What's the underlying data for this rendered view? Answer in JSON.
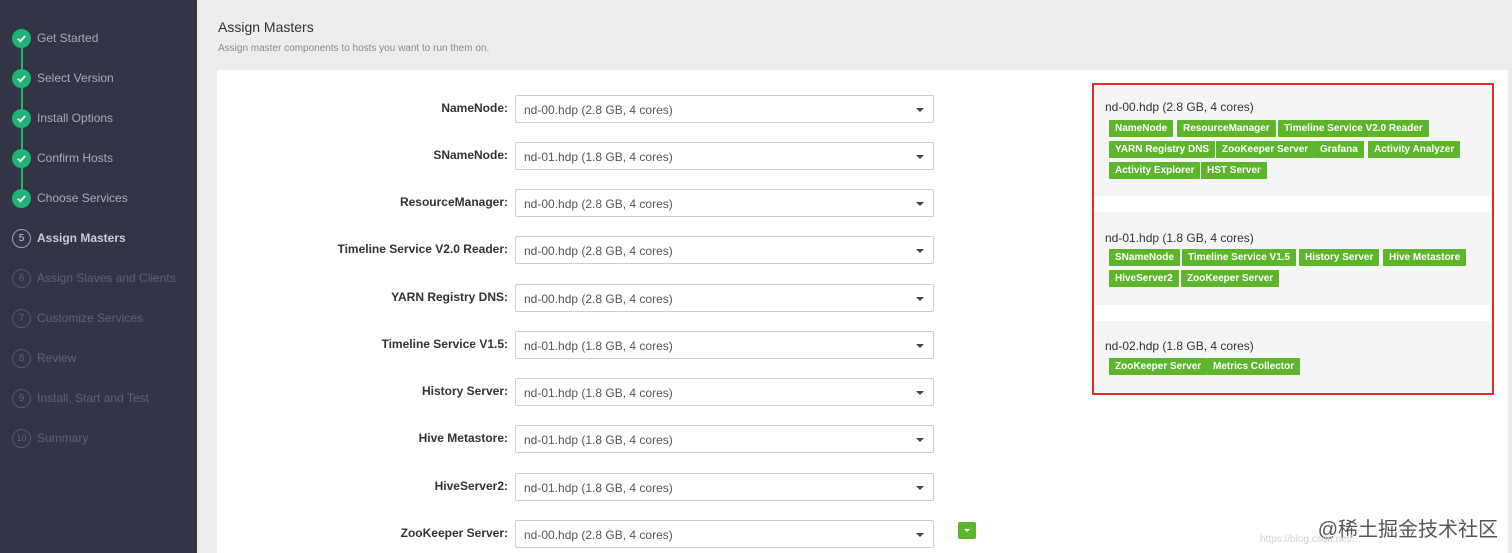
{
  "steps": [
    {
      "label": "Get Started",
      "state": "done"
    },
    {
      "label": "Select Version",
      "state": "done"
    },
    {
      "label": "Install Options",
      "state": "done"
    },
    {
      "label": "Confirm Hosts",
      "state": "done"
    },
    {
      "label": "Choose Services",
      "state": "done"
    },
    {
      "label": "Assign Masters",
      "state": "active",
      "num": "5"
    },
    {
      "label": "Assign Slaves and Clients",
      "state": "todo",
      "num": "6"
    },
    {
      "label": "Customize Services",
      "state": "todo",
      "num": "7"
    },
    {
      "label": "Review",
      "state": "todo",
      "num": "8"
    },
    {
      "label": "Install, Start and Test",
      "state": "todo",
      "num": "9"
    },
    {
      "label": "Summary",
      "state": "todo",
      "num": "10"
    }
  ],
  "header": {
    "title": "Assign Masters",
    "subtitle": "Assign master components to hosts you want to run them on."
  },
  "assignments": [
    {
      "label": "NameNode:",
      "value": "nd-00.hdp (2.8 GB, 4 cores)"
    },
    {
      "label": "SNameNode:",
      "value": "nd-01.hdp (1.8 GB, 4 cores)"
    },
    {
      "label": "ResourceManager:",
      "value": "nd-00.hdp (2.8 GB, 4 cores)"
    },
    {
      "label": "Timeline Service V2.0 Reader:",
      "value": "nd-00.hdp (2.8 GB, 4 cores)"
    },
    {
      "label": "YARN Registry DNS:",
      "value": "nd-00.hdp (2.8 GB, 4 cores)"
    },
    {
      "label": "Timeline Service V1.5:",
      "value": "nd-01.hdp (1.8 GB, 4 cores)"
    },
    {
      "label": "History Server:",
      "value": "nd-01.hdp (1.8 GB, 4 cores)"
    },
    {
      "label": "Hive Metastore:",
      "value": "nd-01.hdp (1.8 GB, 4 cores)"
    },
    {
      "label": "HiveServer2:",
      "value": "nd-01.hdp (1.8 GB, 4 cores)"
    },
    {
      "label": "ZooKeeper Server:",
      "value": "nd-00.hdp (2.8 GB, 4 cores)"
    }
  ],
  "hosts": [
    {
      "name": "nd-00.hdp (2.8 GB, 4 cores)",
      "tags": [
        "NameNode",
        "ResourceManager",
        "Timeline Service V2.0 Reader",
        "YARN Registry DNS",
        "ZooKeeper Server",
        "Grafana",
        "Activity Analyzer",
        "Activity Explorer",
        "HST Server"
      ]
    },
    {
      "name": "nd-01.hdp (1.8 GB, 4 cores)",
      "tags": [
        "SNameNode",
        "Timeline Service V1.5",
        "History Server",
        "Hive Metastore",
        "HiveServer2",
        "ZooKeeper Server"
      ]
    },
    {
      "name": "nd-02.hdp (1.8 GB, 4 cores)",
      "tags": [
        "ZooKeeper Server",
        "Metrics Collector"
      ]
    }
  ],
  "watermark": "@稀土掘金技术社区",
  "watermark_url": "https://blog.csdn.net/..."
}
